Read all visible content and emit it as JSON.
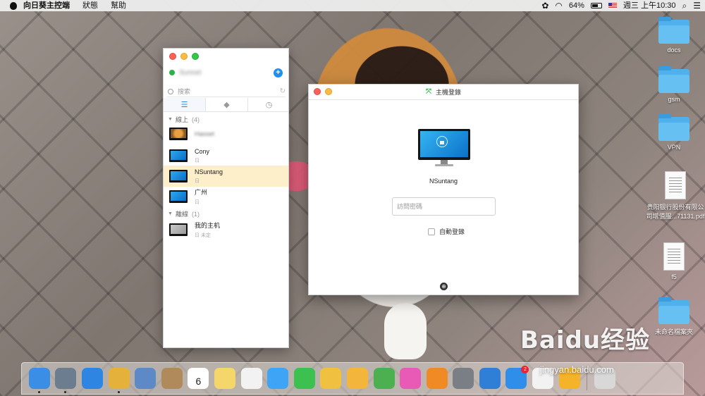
{
  "menubar": {
    "apple_icon": "apple-logo-icon",
    "app_name": "向日葵主控端",
    "menus": [
      "狀態",
      "幫助"
    ],
    "battery_percent": "64%",
    "battery_level": 0.64,
    "datetime": "週三 上午10:30",
    "glyphs": {
      "sunflower": "✿",
      "wifi": "◠",
      "search": "⌕",
      "list": "☰"
    }
  },
  "desktop": {
    "icons": [
      {
        "label": "docs",
        "kind": "folder"
      },
      {
        "label": "gsm",
        "kind": "folder"
      },
      {
        "label": "VPN",
        "kind": "folder"
      },
      {
        "label": "贵阳银行股份有限公司增值服...71131.pdf",
        "kind": "document"
      },
      {
        "label": "f5",
        "kind": "document"
      },
      {
        "label": "未命名檔案夾",
        "kind": "folder"
      }
    ]
  },
  "sidebar": {
    "account_name": "Sunnet",
    "add_glyph": "+",
    "search_placeholder": "搜索",
    "refresh_glyph": "↻",
    "tabs": [
      {
        "name": "list",
        "glyph": "☰"
      },
      {
        "name": "tag",
        "glyph": "◆"
      },
      {
        "name": "history",
        "glyph": "◷"
      }
    ],
    "groups": [
      {
        "title": "線上",
        "count": "(4)"
      },
      {
        "title": "離線",
        "count": "(1)"
      }
    ],
    "hosts": [
      {
        "name": "Hasset",
        "sub": "",
        "blurred": true
      },
      {
        "name": "Cony",
        "sub": "ㄖ"
      },
      {
        "name": "NSuntang",
        "sub": "ㄖ",
        "selected": true
      },
      {
        "name": "广州",
        "sub": "ㄖ"
      },
      {
        "name": "我的主机",
        "sub": "ㄖ 未定"
      }
    ]
  },
  "login": {
    "title": "主機登錄",
    "title_glyph": "⤧",
    "host_name": "NSuntang",
    "password_placeholder": "訪問密碼",
    "password_value": "",
    "auto_login_label": "自動登錄",
    "auto_login_checked": false,
    "footer_glyph": "⊕"
  },
  "dock": {
    "apps": [
      {
        "name": "finder",
        "color": "#3a8ee6",
        "running": true
      },
      {
        "name": "launchpad",
        "color": "#6b7d8f",
        "running": true
      },
      {
        "name": "safari",
        "color": "#2f86e2",
        "running": false
      },
      {
        "name": "chrome",
        "color": "#e4b23a",
        "running": true
      },
      {
        "name": "preview",
        "color": "#5d8ac7",
        "running": false
      },
      {
        "name": "contacts",
        "color": "#b08a5a",
        "running": false
      },
      {
        "name": "calendar",
        "color": "#ffffff",
        "running": false,
        "day": "6"
      },
      {
        "name": "notes",
        "color": "#f5d66a",
        "running": false
      },
      {
        "name": "reminders",
        "color": "#f2f2f2",
        "running": false
      },
      {
        "name": "messages",
        "color": "#3ea4f6",
        "running": false
      },
      {
        "name": "facetime",
        "color": "#3cc150",
        "running": false
      },
      {
        "name": "photos",
        "color": "#f0c040",
        "running": false
      },
      {
        "name": "notes-keynote",
        "color": "#f3b53c",
        "running": false
      },
      {
        "name": "numbers",
        "color": "#4db050",
        "running": false
      },
      {
        "name": "itunes",
        "color": "#e85ab5",
        "running": false
      },
      {
        "name": "ibooks",
        "color": "#f08a24",
        "running": false
      },
      {
        "name": "system-preferences",
        "color": "#7a7e85",
        "running": false
      },
      {
        "name": "keynote",
        "color": "#2f7fd6",
        "running": false
      },
      {
        "name": "app-store",
        "color": "#2f8ee9",
        "running": false,
        "badge": "2"
      },
      {
        "name": "qq",
        "color": "#f2f2f2",
        "running": false
      },
      {
        "name": "sunlogin",
        "color": "#f5b32a",
        "running": false
      }
    ],
    "trash_color": "#d8d8d8"
  },
  "watermark": {
    "brand": "Baidu经验",
    "url": "jingyan.baidu.com"
  }
}
